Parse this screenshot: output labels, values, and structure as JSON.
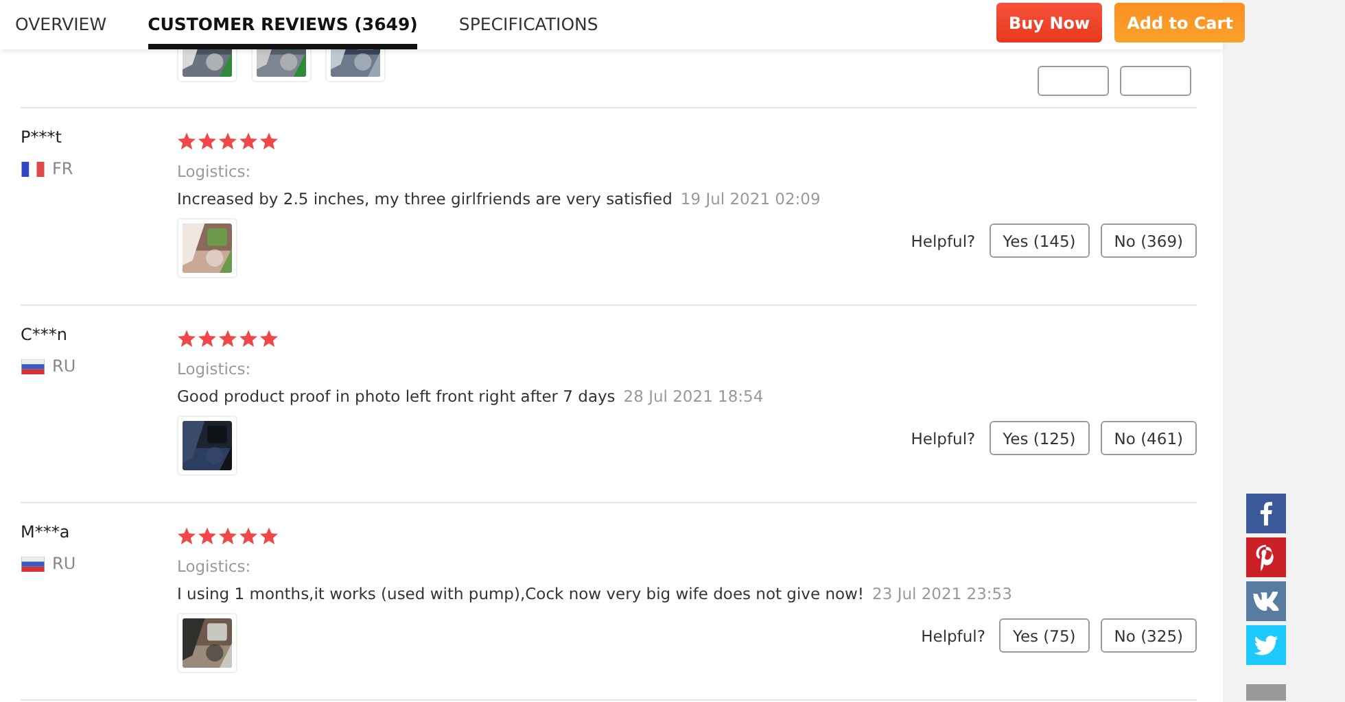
{
  "tabs": [
    {
      "label": "OVERVIEW",
      "selected": false
    },
    {
      "label": "CUSTOMER REVIEWS (3649)",
      "selected": true
    },
    {
      "label": "SPECIFICATIONS",
      "selected": false
    }
  ],
  "actions": [
    {
      "label": "Buy Now",
      "kind": "buy"
    },
    {
      "label": "Add to Cart",
      "kind": "cart"
    }
  ],
  "reviews": [
    {
      "name": "P***t",
      "flag": {
        "kind": "fr"
      },
      "country": "FR",
      "stars": 5,
      "logistics": "Logistics:",
      "text": "Increased by 2.5 inches, my three girlfriends are very satisfied",
      "date": "19 Jul 2021 02:09",
      "helpful": "Helpful?",
      "yes": "Yes (145)",
      "no": "No (369)"
    },
    {
      "name": "C***n",
      "flag": {
        "kind": "ru"
      },
      "country": "RU",
      "stars": 5,
      "logistics": "Logistics:",
      "text": "Good product proof in photo left front right after 7 days",
      "date": "28 Jul 2021 18:54",
      "helpful": "Helpful?",
      "yes": "Yes (125)",
      "no": "No (461)"
    },
    {
      "name": "M***a",
      "flag": {
        "kind": "ru"
      },
      "country": "RU",
      "stars": 5,
      "logistics": "Logistics:",
      "text": "I using 1 months,it works (used with pump),Cock now very big wife does not give now!",
      "date": "23 Jul 2021 23:53",
      "helpful": "Helpful?",
      "yes": "Yes (75)",
      "no": "No (325)"
    }
  ],
  "share": [
    {
      "kind": "facebook"
    },
    {
      "kind": "pinterest"
    },
    {
      "kind": "vk"
    },
    {
      "kind": "twitter"
    }
  ]
}
